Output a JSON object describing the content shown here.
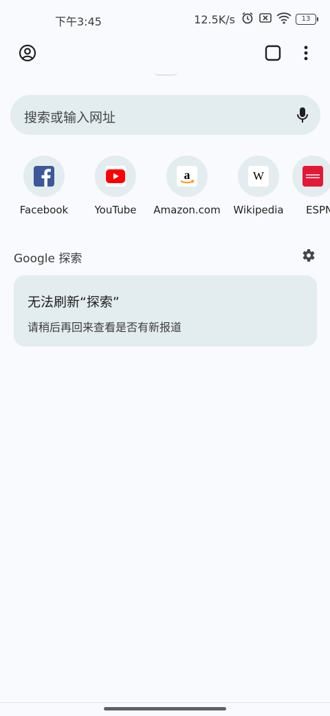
{
  "status": {
    "time": "下午3:45",
    "speed": "12.5K/s",
    "battery": "13",
    "icons": [
      "alarm-icon",
      "sim-off-icon",
      "wifi-icon",
      "battery-icon"
    ]
  },
  "toolbar": {
    "icons": [
      "account-icon",
      "tab-switcher-icon",
      "more-menu-icon"
    ]
  },
  "search": {
    "placeholder": "搜索或输入网址",
    "mic_icon": "mic-icon"
  },
  "shortcuts": [
    {
      "label": "Facebook",
      "icon": "facebook-icon"
    },
    {
      "label": "YouTube",
      "icon": "youtube-icon"
    },
    {
      "label": "Amazon.com",
      "icon": "amazon-icon"
    },
    {
      "label": "Wikipedia",
      "icon": "wikipedia-icon"
    },
    {
      "label": "ESPN",
      "icon": "espn-icon"
    }
  ],
  "discover": {
    "title": "Google 探索",
    "settings_icon": "settings-icon",
    "card_title": "无法刷新“探索”",
    "card_body": "请稍后再回来查看是否有新报道"
  },
  "colors": {
    "background": "#f8fafd",
    "surface": "#e3ecef",
    "text": "#1f1f1f",
    "facebook": "#3b5998",
    "youtube": "#ff0000",
    "espn": "#e31837"
  }
}
